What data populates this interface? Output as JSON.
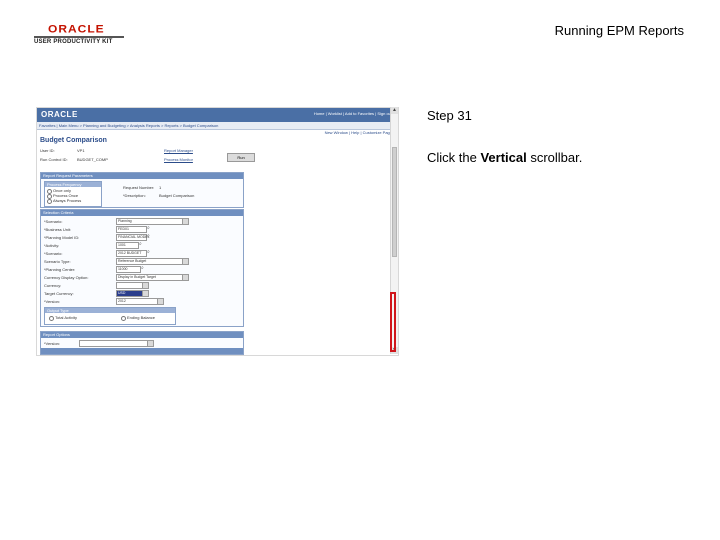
{
  "header": {
    "logo_main": "ORACLE",
    "logo_sub": "USER PRODUCTIVITY KIT",
    "doc_title": "Running EPM Reports"
  },
  "step": {
    "title": "Step 31",
    "instruction_prefix": "Click the ",
    "instruction_target": "Vertical",
    "instruction_suffix": " scrollbar."
  },
  "screenshot": {
    "brand": "ORACLE",
    "top_links": "Home | Worklist | Add to Favorites | Sign out",
    "nav": "Favorites | Main Menu > Planning and Budgeting > Analysis Reports > Reports > Budget Comparison",
    "page_links": "New Window | Help | Customize Page",
    "page_title": "Budget Comparison",
    "user_id_label": "User ID:",
    "user_id_value": "VP1",
    "run_control_label": "Run Control ID:",
    "run_control_value": "BUDGET_COMP",
    "report_manager_link": "Report Manager",
    "process_monitor_link": "Process Monitor",
    "run_button": "Run",
    "section1": "Report Request Parameters",
    "process_frequency": "Process Frequency",
    "freq_options": [
      "Once only",
      "Process Once",
      "Always Process"
    ],
    "request_number_label": "Request Number:",
    "request_number_value": "1",
    "description_label": "*Description:",
    "description_value": "Budget Comparison",
    "section2": "Selection Criteria",
    "field_labels": [
      "*Scenario:",
      "*Business Unit:",
      "*Planning Model ID:",
      "*Activity:",
      "*Scenario:",
      "Scenario Type:",
      "*Planning Center:",
      "Currency Display Option:",
      "Currency:",
      "Target Currency:",
      "*Version:"
    ],
    "field_values": [
      "Planning",
      "FED01",
      "FINANCIAL MODEL",
      "1001",
      "2012 BUDGET",
      "Reference Budget",
      "11000",
      "Display in Budget Target",
      "",
      "USD",
      "2012"
    ],
    "output_format": "Output Type",
    "output_options": [
      "Total Activity",
      "Ending Balance"
    ],
    "section3": "Report Options",
    "version_label": "*Version:"
  }
}
